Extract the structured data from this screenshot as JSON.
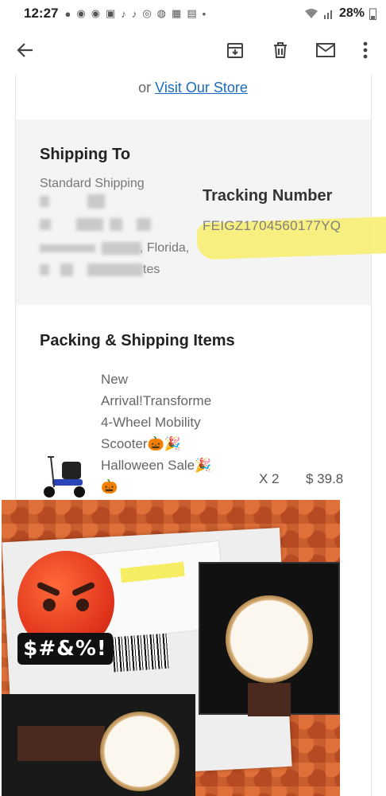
{
  "status_bar": {
    "time": "12:27",
    "battery": "28%"
  },
  "toolbar": {
    "icons": [
      "back-arrow-icon",
      "archive-icon",
      "delete-icon",
      "mail-icon",
      "more-vert-icon"
    ]
  },
  "store": {
    "prefix": "or",
    "link": "Visit Our Store"
  },
  "shipping": {
    "title": "Shipping To",
    "method": "Standard Shipping",
    "address_fragments": [
      ", Florida,",
      "tes"
    ],
    "tracking_title": "Tracking Number",
    "tracking_number": "FEIGZ1704560177YQ"
  },
  "packing": {
    "title": "Packing & Shipping Items",
    "item_name": "New\nArrival!Transforme\n4-Wheel Mobility\nScooter🎃🎉\nHalloween Sale🎉\n🎃",
    "quantity": "X 2",
    "price": "$ 39.8"
  },
  "photo": {
    "censor_text": "$#&%!"
  },
  "colors": {
    "link": "#1a6bbf",
    "highlight": "#f7ef6b",
    "panel": "#f4f4f4"
  }
}
